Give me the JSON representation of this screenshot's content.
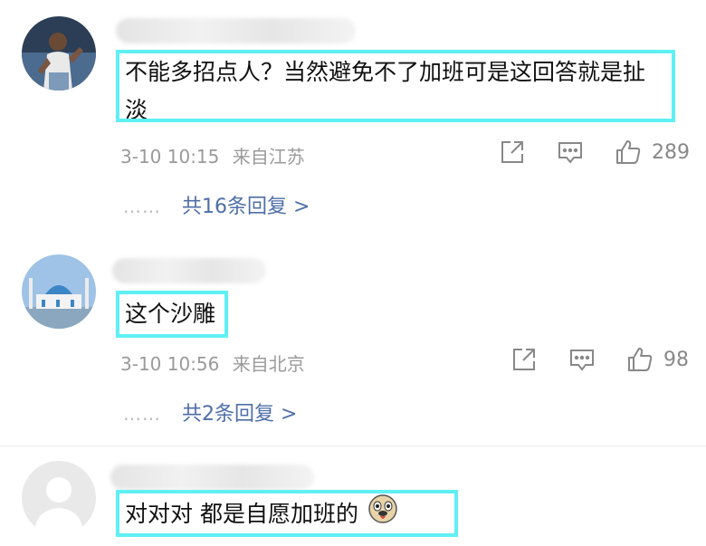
{
  "comments": [
    {
      "text": "不能多招点人？当然避免不了加班可是这回答就是扯淡",
      "time": "3-10 10:15",
      "location": "来自江苏",
      "likes": "289",
      "replies": "共16条回复 >"
    },
    {
      "text": "这个沙雕",
      "time": "3-10 10:56",
      "location": "来自北京",
      "likes": "98",
      "replies": "共2条回复 >"
    },
    {
      "text": "对对对 都是自愿加班的"
    }
  ],
  "reply_dots": "……",
  "icons": {
    "share": "share-icon",
    "comment": "comment-icon",
    "like": "thumbs-up-icon",
    "emoji": "doge-emoji-icon"
  },
  "colors": {
    "highlight": "#5ff0f5",
    "link": "#4e6ea8",
    "meta": "#9a9a9a"
  }
}
